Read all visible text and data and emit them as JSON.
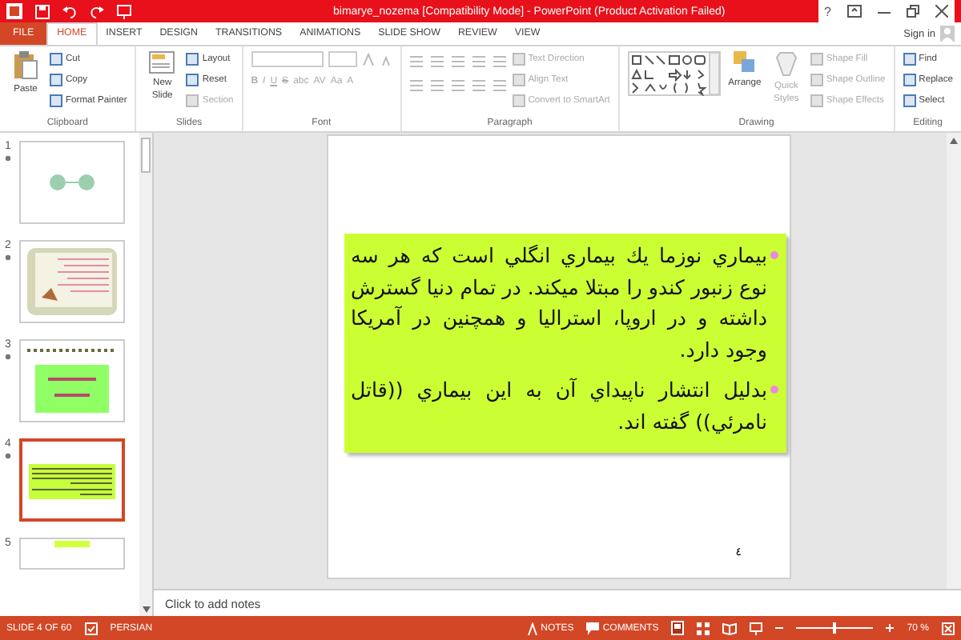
{
  "window": {
    "title": "bimarye_nozema [Compatibility Mode] - PowerPoint (Product Activation Failed)",
    "help": "?"
  },
  "tabs": [
    {
      "label": "FILE",
      "kind": "file",
      "selected": false
    },
    {
      "label": "HOME",
      "kind": "tab",
      "selected": true
    },
    {
      "label": "INSERT",
      "kind": "tab",
      "selected": false
    },
    {
      "label": "DESIGN",
      "kind": "tab",
      "selected": false
    },
    {
      "label": "TRANSITIONS",
      "kind": "tab",
      "selected": false
    },
    {
      "label": "ANIMATIONS",
      "kind": "tab",
      "selected": false
    },
    {
      "label": "SLIDE SHOW",
      "kind": "tab",
      "selected": false
    },
    {
      "label": "REVIEW",
      "kind": "tab",
      "selected": false
    },
    {
      "label": "VIEW",
      "kind": "tab",
      "selected": false
    }
  ],
  "sign_in": "Sign in",
  "clipboard": {
    "label": "Clipboard",
    "paste": "Paste",
    "items": [
      {
        "label": "Cut",
        "disabled": false
      },
      {
        "label": "Copy",
        "disabled": false
      },
      {
        "label": "Format Painter",
        "disabled": false
      }
    ]
  },
  "slides_group": {
    "label": "Slides",
    "new_slide": "New Slide",
    "items": [
      {
        "label": "Layout",
        "disabled": false
      },
      {
        "label": "Reset",
        "disabled": false
      },
      {
        "label": "Section",
        "disabled": true
      }
    ]
  },
  "font": {
    "label": "Font",
    "buttons": [
      "B",
      "I",
      "U",
      "S",
      "abc",
      "AV",
      "Aa",
      "A"
    ]
  },
  "paragraph": {
    "label": "Paragraph",
    "items": [
      {
        "label": "Text Direction",
        "disabled": true
      },
      {
        "label": "Align Text",
        "disabled": true
      },
      {
        "label": "Convert to SmartArt",
        "disabled": true
      }
    ]
  },
  "drawing": {
    "label": "Drawing",
    "arrange": "Arrange",
    "quick_styles": "Quick Styles",
    "items": [
      {
        "label": "Shape Fill",
        "disabled": true
      },
      {
        "label": "Shape Outline",
        "disabled": true
      },
      {
        "label": "Shape Effects",
        "disabled": true
      }
    ]
  },
  "editing": {
    "label": "Editing",
    "items": [
      {
        "label": "Find",
        "disabled": false
      },
      {
        "label": "Replace",
        "disabled": false
      },
      {
        "label": "Select",
        "disabled": false
      }
    ]
  },
  "thumbnails": [
    {
      "number": "1",
      "kind": "ornament",
      "selected": false
    },
    {
      "number": "2",
      "kind": "card",
      "selected": false
    },
    {
      "number": "3",
      "kind": "green",
      "selected": false
    },
    {
      "number": "4",
      "kind": "text",
      "selected": true
    },
    {
      "number": "5",
      "kind": "partial",
      "selected": false
    }
  ],
  "slide": {
    "paragraphs": [
      "بيماري نوزما يك بيماري انگلي است كه هر سه نوع زنبور كندو را مبتلا ميكند. در تمام دنيا گسترش داشته و در اروپا، استراليا و همچنين در آمريكا وجود دارد.",
      "بدليل انتشار ناپيداي آن به اين بيماري ((قاتل نامرئي)) گفته اند."
    ],
    "number": "٤"
  },
  "notes": {
    "placeholder": "Click to add notes"
  },
  "status_bar": {
    "slide": "SLIDE 4 OF 60",
    "language": "PERSIAN",
    "notes": "NOTES",
    "comments": "COMMENTS",
    "zoom": "70 %",
    "zoom_slider": {
      "level": 0.5
    }
  }
}
